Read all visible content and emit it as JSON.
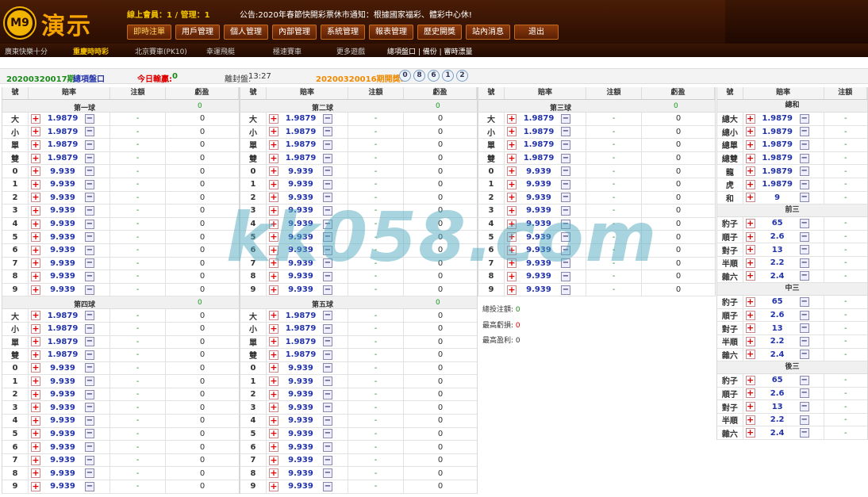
{
  "header": {
    "logo": "M9",
    "brand": "演示",
    "online": "線上會員：1 / 管理：1",
    "notice": "公告:2020年春節快開彩票休市通知：根據國家福彩、體彩中心休!"
  },
  "menu": [
    "即時注單",
    "用戶管理",
    "個人管理",
    "內部管理",
    "系統管理",
    "報表管理",
    "歷史開獎",
    "站內消息",
    "退出"
  ],
  "submenu": [
    "廣東快樂十分",
    "重慶時時彩",
    "北京賽車(PK10)",
    "幸運飛艇",
    "極速賽車",
    "更多遊戲",
    "總項盤口 | 備份 | 審時漂量"
  ],
  "info": {
    "period": "20200320017期",
    "pan": "總項盤口",
    "today_label": "今日輸贏:",
    "today_val": "0",
    "close_label": "離封盤:",
    "close_time": "13:27",
    "last_label": "20200320016期開獎:",
    "balls": [
      "0",
      "8",
      "6",
      "1",
      "2"
    ]
  },
  "headers": {
    "h1": "號",
    "h2": "賠率",
    "h3": "注額",
    "h4": "虧盈"
  },
  "groups": [
    {
      "title": "第一球",
      "val": "0"
    },
    {
      "title": "第二球",
      "val": "0"
    },
    {
      "title": "第三球",
      "val": "0"
    },
    {
      "title": "第四球",
      "val": "0"
    },
    {
      "title": "第五球",
      "val": "0"
    }
  ],
  "ball_rows": [
    {
      "k": "大",
      "o": "1.9879"
    },
    {
      "k": "小",
      "o": "1.9879"
    },
    {
      "k": "單",
      "o": "1.9879"
    },
    {
      "k": "雙",
      "o": "1.9879"
    },
    {
      "k": "0",
      "o": "9.939"
    },
    {
      "k": "1",
      "o": "9.939"
    },
    {
      "k": "2",
      "o": "9.939"
    },
    {
      "k": "3",
      "o": "9.939"
    },
    {
      "k": "4",
      "o": "9.939"
    },
    {
      "k": "5",
      "o": "9.939"
    },
    {
      "k": "6",
      "o": "9.939"
    },
    {
      "k": "7",
      "o": "9.939"
    },
    {
      "k": "8",
      "o": "9.939"
    },
    {
      "k": "9",
      "o": "9.939"
    }
  ],
  "cell_dash": "-",
  "cell_zero": "0",
  "sum_title": "總和",
  "sum_rows": [
    {
      "k": "總大",
      "o": "1.9879"
    },
    {
      "k": "總小",
      "o": "1.9879"
    },
    {
      "k": "總單",
      "o": "1.9879"
    },
    {
      "k": "總雙",
      "o": "1.9879"
    },
    {
      "k": "龍",
      "o": "1.9879"
    },
    {
      "k": "虎",
      "o": "1.9879"
    },
    {
      "k": "和",
      "o": "9"
    }
  ],
  "triples": [
    {
      "title": "前三"
    },
    {
      "title": "中三"
    },
    {
      "title": "後三"
    }
  ],
  "triple_rows": [
    {
      "k": "豹子",
      "o": "65"
    },
    {
      "k": "順子",
      "o": "2.6"
    },
    {
      "k": "對子",
      "o": "13"
    },
    {
      "k": "半順",
      "o": "2.2"
    },
    {
      "k": "雜六",
      "o": "2.4"
    }
  ],
  "summary": {
    "l1": "總投注額:",
    "v1": "0",
    "l2": "最高虧損:",
    "v2": "0",
    "l3": "最高盈利:",
    "v3": "0"
  },
  "watermark": "kk058.com"
}
